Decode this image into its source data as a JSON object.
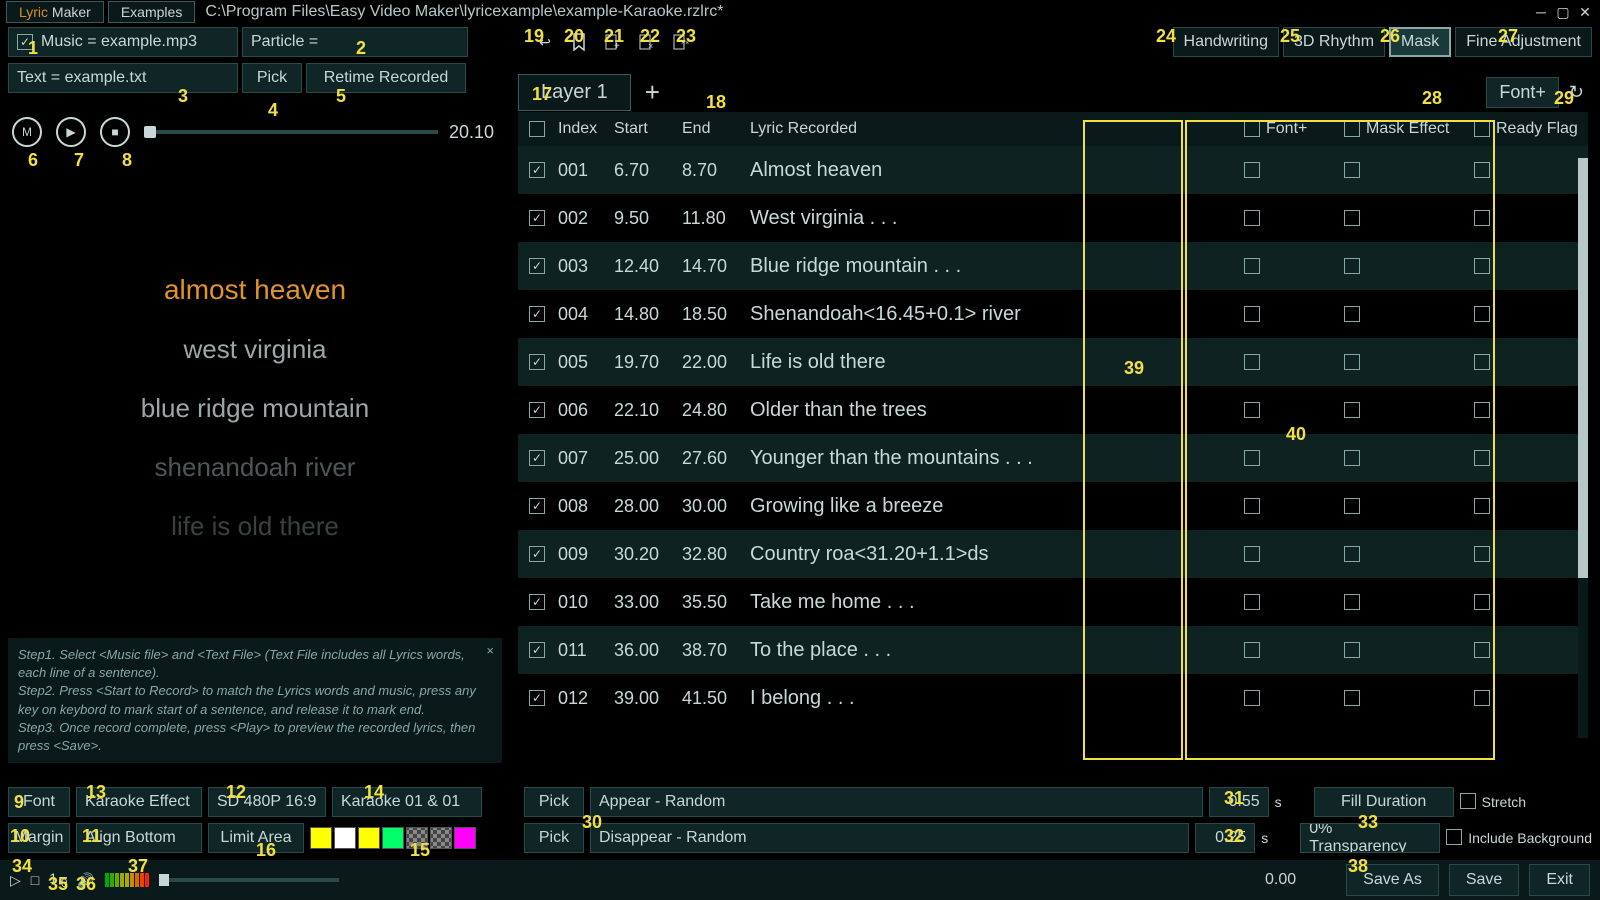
{
  "titlebar": {
    "tab1_orange": "Lyric",
    "tab1_rest": " Maker",
    "tab2": "Examples",
    "filepath": "C:\\Program Files\\Easy Video Maker\\lyricexample\\example-Karaoke.rzlrc*"
  },
  "top": {
    "music_field": "Music = example.mp3",
    "particle_field": "Particle =",
    "text_field": "Text = example.txt",
    "pick": "Pick",
    "retime": "Retime Recorded",
    "time_display": "20.10",
    "handwriting": "Handwriting",
    "rhythm3d": "3D Rhythm",
    "mask": "Mask",
    "fine": "Fine Adjustment",
    "layer1": "Layer 1",
    "fontplus": "Font+"
  },
  "preview_lines": [
    "almost heaven",
    "west virginia",
    "blue ridge mountain",
    "shenandoah river",
    "life is old there"
  ],
  "help": {
    "step1": "Step1. Select <Music file> and <Text File> (Text File includes all Lyrics words, each line of a sentence).",
    "step2": "Step2. Press <Start to Record> to match the Lyrics words and music, press any key on keybord to mark start of a sentence, and release it to mark end.",
    "step3": "Step3. Once record complete, press <Play> to preview the recorded lyrics, then press <Save>."
  },
  "table": {
    "headers": {
      "index": "Index",
      "start": "Start",
      "end": "End",
      "lyric": "Lyric Recorded",
      "font": "Font+",
      "mask": "Mask Effect",
      "ready": "Ready Flag"
    },
    "rows": [
      {
        "idx": "001",
        "start": "6.70",
        "end": "8.70",
        "lyric": "Almost heaven"
      },
      {
        "idx": "002",
        "start": "9.50",
        "end": "11.80",
        "lyric": "West virginia . . ."
      },
      {
        "idx": "003",
        "start": "12.40",
        "end": "14.70",
        "lyric": "Blue ridge mountain . . ."
      },
      {
        "idx": "004",
        "start": "14.80",
        "end": "18.50",
        "lyric": "Shenandoah<16.45+0.1> river"
      },
      {
        "idx": "005",
        "start": "19.70",
        "end": "22.00",
        "lyric": "Life is old there"
      },
      {
        "idx": "006",
        "start": "22.10",
        "end": "24.80",
        "lyric": "Older than the trees"
      },
      {
        "idx": "007",
        "start": "25.00",
        "end": "27.60",
        "lyric": "Younger than the mountains . . ."
      },
      {
        "idx": "008",
        "start": "28.00",
        "end": "30.00",
        "lyric": "Growing like a breeze"
      },
      {
        "idx": "009",
        "start": "30.20",
        "end": "32.80",
        "lyric": "Country roa<31.20+1.1>ds"
      },
      {
        "idx": "010",
        "start": "33.00",
        "end": "35.50",
        "lyric": "Take me home . . ."
      },
      {
        "idx": "011",
        "start": "36.00",
        "end": "38.70",
        "lyric": "To the place . . ."
      },
      {
        "idx": "012",
        "start": "39.00",
        "end": "41.50",
        "lyric": "I belong . . ."
      }
    ]
  },
  "bottom": {
    "font": "Font",
    "karaoke_effect": "Karaoke Effect",
    "resolution": "SD 480P 16:9",
    "karaoke_preset": "Karaoke 01 & 01",
    "margin": "Margin",
    "align": "Align Bottom",
    "limit": "Limit Area",
    "pick": "Pick",
    "appear": "Appear - Random",
    "disappear": "Disappear - Random",
    "appear_val": "0.55",
    "disappear_val": "0.25",
    "sec": "s",
    "fill_duration": "Fill Duration",
    "stretch": "Stretch",
    "transparency": "0% Transparency",
    "include_bg": "Include Background",
    "swatches": [
      "#ffff00",
      "#ffffff",
      "#ffff00",
      "#00ff66",
      "checker",
      "checker",
      "#ff00ff"
    ]
  },
  "footer": {
    "loop_num": "1",
    "loop_den": "0",
    "progress": "0.00",
    "save_as": "Save As",
    "save": "Save",
    "exit": "Exit"
  },
  "labels": {
    "1": "1",
    "2": "2",
    "3": "3",
    "4": "4",
    "5": "5",
    "6": "6",
    "7": "7",
    "8": "8",
    "9": "9",
    "10": "10",
    "11": "11",
    "12": "12",
    "13": "13",
    "14": "14",
    "15": "15",
    "16": "16",
    "17": "17",
    "18": "18",
    "19": "19",
    "20": "20",
    "21": "21",
    "22": "22",
    "23": "23",
    "24": "24",
    "25": "25",
    "26": "26",
    "27": "27",
    "28": "28",
    "29": "29",
    "30": "30",
    "31": "31",
    "32": "32",
    "33": "33",
    "34": "34",
    "35": "35",
    "36": "36",
    "37": "37",
    "38": "38",
    "39": "39",
    "40": "40"
  }
}
